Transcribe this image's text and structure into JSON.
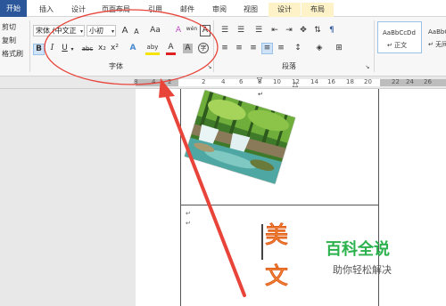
{
  "tabs": [
    "开始",
    "插入",
    "设计",
    "页面布局",
    "引用",
    "邮件",
    "审阅",
    "视图",
    "设计",
    "布局"
  ],
  "clipboard": {
    "cut": "剪切",
    "copy": "复制",
    "format_painter": "格式刷"
  },
  "font": {
    "name": "宋体 (中文正",
    "size": "小初",
    "grow": "A",
    "shrink": "A",
    "change_case": "Aa",
    "clear_format": "A",
    "phonetic": "wén",
    "border": "A",
    "bold": "B",
    "italic": "I",
    "underline": "U",
    "strike": "abc",
    "subscript": "x₂",
    "superscript": "x²",
    "effects": "A",
    "highlight": "aby",
    "color": "A",
    "shading": "A",
    "enclose": "字",
    "group_label": "字体"
  },
  "paragraph": {
    "group_label": "段落"
  },
  "styles": [
    {
      "preview": "AaBbCcDd",
      "name": "↵ 正文"
    },
    {
      "preview": "AaBbC",
      "name": "↵ 无间"
    }
  ],
  "ruler": [
    "8",
    "4",
    "2",
    "2",
    "4",
    "6",
    "8",
    "10",
    "12",
    "14",
    "16",
    "18",
    "20",
    "22",
    "24",
    "26",
    "28",
    "32"
  ],
  "document": {
    "paragraph_mark": "↵",
    "vertical_text": [
      "美",
      "文"
    ]
  },
  "watermark": {
    "title": "百科全说",
    "subtitle": "助你轻松解决"
  },
  "colors": {
    "accent": "#2b579a",
    "annotation": "#e8443a",
    "title_green": "#2bb24c",
    "text_orange": "#f08a3a"
  }
}
